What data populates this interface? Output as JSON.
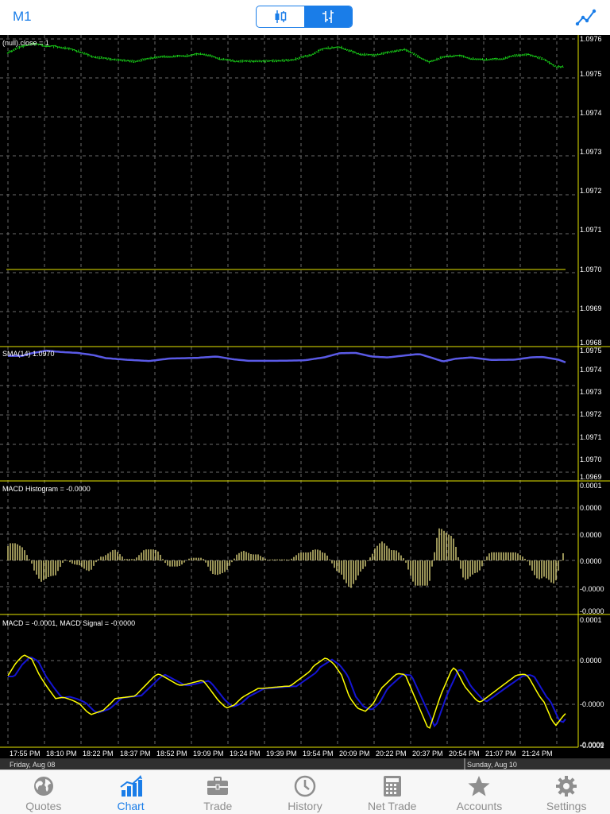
{
  "header": {
    "timeframe": "M1"
  },
  "panels": {
    "price_label": "(null).close = 1",
    "sma_label": "SMA(14) 1.0970",
    "hist_label": "MACD Histogram = -0.0000",
    "macd_label": "MACD = -0.0001, MACD Signal = -0.0000"
  },
  "axes": {
    "price_ticks": [
      "1.0976",
      "1.0975",
      "1.0974",
      "1.0973",
      "1.0972",
      "1.0971",
      "1.0970",
      "1.0969",
      "1.0968"
    ],
    "sma_ticks": [
      "1.0975",
      "1.0974",
      "1.0973",
      "1.0972",
      "1.0971",
      "1.0970",
      "1.0969"
    ],
    "hist_ticks": [
      "0.0001",
      "0.0000",
      "0.0000",
      "0.0000",
      "-0.0000",
      "-0.0000"
    ],
    "macd_ticks": [
      "0.0001",
      "0.0000",
      "-0.0000",
      "-0.0000",
      "-0.0001"
    ],
    "time_labels": [
      "17:55 PM",
      "18:10 PM",
      "18:22 PM",
      "18:37 PM",
      "18:52 PM",
      "19:09 PM",
      "19:24 PM",
      "19:39 PM",
      "19:54 PM",
      "20:09 PM",
      "20:22 PM",
      "20:37 PM",
      "20:54 PM",
      "21:07 PM",
      "21:24 PM"
    ],
    "date_labels": [
      "Friday, Aug 08",
      "Sunday, Aug 10"
    ]
  },
  "colors": {
    "accent": "#1a7de8",
    "bull": "#19d219",
    "level": "#e6e600",
    "sma": "#5a5ae6",
    "macd": "#ffff00",
    "signal": "#1414d2",
    "hist": "#d9d07a",
    "grid": "#6a6a6a"
  },
  "tabs": [
    {
      "id": "quotes",
      "label": "Quotes",
      "icon": "globe-icon"
    },
    {
      "id": "chart",
      "label": "Chart",
      "icon": "bar-chart-icon",
      "active": true
    },
    {
      "id": "trade",
      "label": "Trade",
      "icon": "briefcase-icon"
    },
    {
      "id": "history",
      "label": "History",
      "icon": "clock-icon"
    },
    {
      "id": "nettrade",
      "label": "Net Trade",
      "icon": "calculator-icon"
    },
    {
      "id": "accounts",
      "label": "Accounts",
      "icon": "star-icon"
    },
    {
      "id": "settings",
      "label": "Settings",
      "icon": "gear-icon"
    }
  ]
}
